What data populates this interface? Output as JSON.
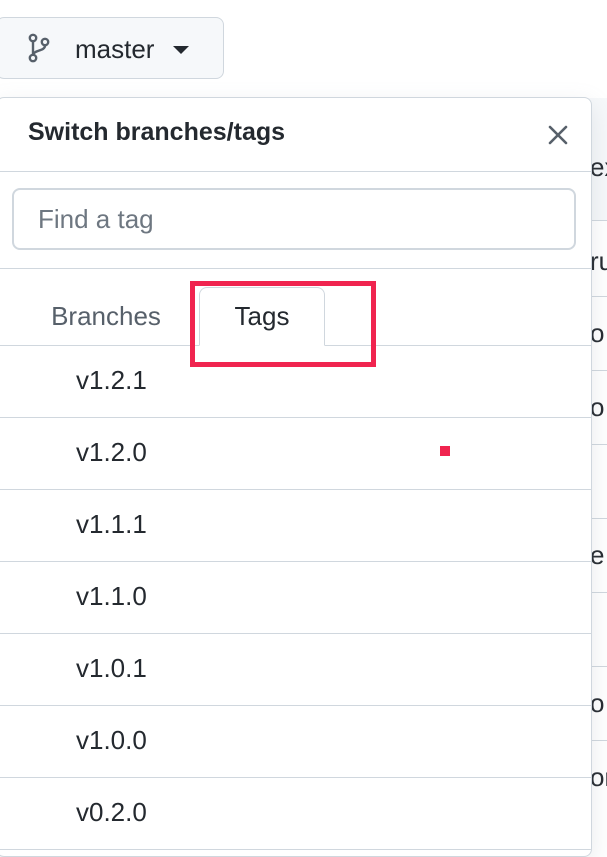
{
  "branch_button": {
    "label": "master",
    "icon": "git-branch-icon"
  },
  "panel": {
    "title": "Switch branches/tags",
    "close_icon": "close-icon",
    "filter": {
      "placeholder": "Find a tag",
      "value": ""
    },
    "tabs": [
      {
        "label": "Branches",
        "selected": false
      },
      {
        "label": "Tags",
        "selected": true
      }
    ],
    "tags": [
      "v1.2.1",
      "v1.2.0",
      "v1.1.1",
      "v1.1.0",
      "v1.0.1",
      "v1.0.0",
      "v0.2.0"
    ]
  },
  "background_fragments": [
    "ex",
    "ru",
    "o",
    "o",
    "e",
    "o",
    "or"
  ],
  "colors": {
    "highlight": "#f0244f",
    "border": "#d0d7de",
    "text": "#24292f",
    "muted": "#57606a"
  }
}
